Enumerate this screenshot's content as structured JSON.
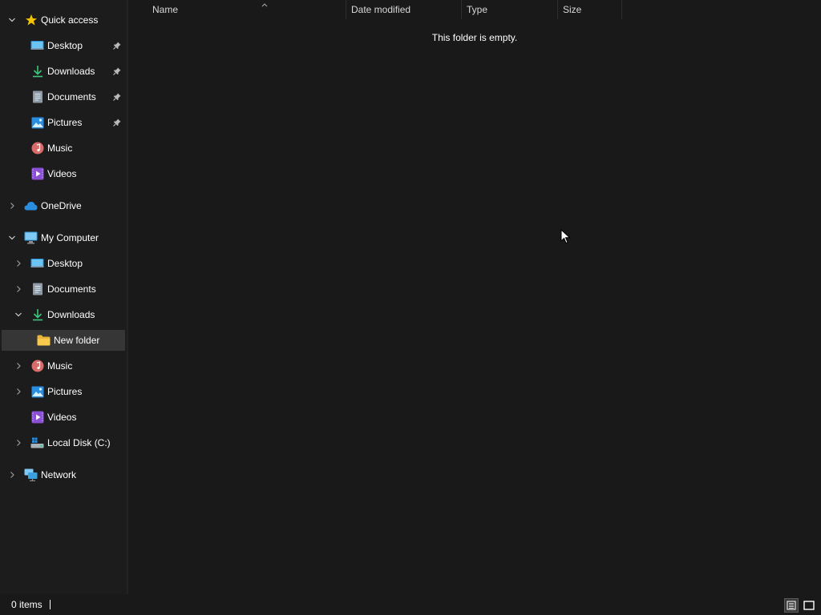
{
  "sidebar": {
    "quick_access": {
      "label": "Quick access",
      "items": [
        {
          "label": "Desktop",
          "icon": "desktop-icon",
          "pinned": true
        },
        {
          "label": "Downloads",
          "icon": "download-icon",
          "pinned": true
        },
        {
          "label": "Documents",
          "icon": "documents-icon",
          "pinned": true
        },
        {
          "label": "Pictures",
          "icon": "pictures-icon",
          "pinned": true
        },
        {
          "label": "Music",
          "icon": "music-icon",
          "pinned": false
        },
        {
          "label": "Videos",
          "icon": "videos-icon",
          "pinned": false
        }
      ]
    },
    "onedrive": {
      "label": "OneDrive",
      "icon": "cloud-icon"
    },
    "my_computer": {
      "label": "My Computer",
      "items": [
        {
          "label": "Desktop",
          "icon": "desktop-icon"
        },
        {
          "label": "Documents",
          "icon": "documents-icon"
        },
        {
          "label": "Downloads",
          "icon": "download-icon",
          "expanded": true
        },
        {
          "label": "New folder",
          "icon": "folder-icon",
          "selected": true
        },
        {
          "label": "Music",
          "icon": "music-icon"
        },
        {
          "label": "Pictures",
          "icon": "pictures-icon"
        },
        {
          "label": "Videos",
          "icon": "videos-icon"
        },
        {
          "label": "Local Disk (C:)",
          "icon": "drive-icon"
        }
      ]
    },
    "network": {
      "label": "Network",
      "icon": "network-icon"
    }
  },
  "columns": {
    "name": "Name",
    "date_modified": "Date modified",
    "type": "Type",
    "size": "Size"
  },
  "content": {
    "empty_message": "This folder is empty."
  },
  "statusbar": {
    "items_count": "0 items"
  },
  "colors": {
    "background": "#191919",
    "sidebar": "#1c1c1c",
    "selected": "#363636",
    "folder": "#f8c94a",
    "star": "#f5c400",
    "download": "#3cc87a",
    "cloud": "#2a8ee0"
  }
}
